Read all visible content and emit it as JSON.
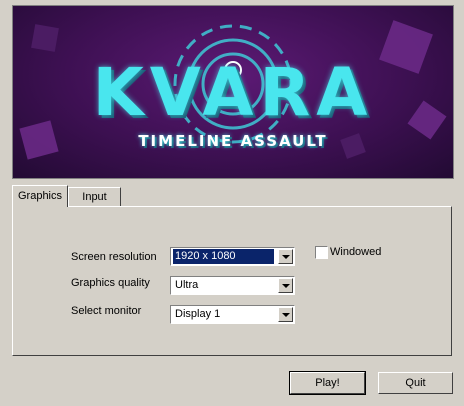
{
  "banner": {
    "logo_title": "KVARA",
    "logo_subtitle": "TIMELINE ASSAULT",
    "colors": {
      "background": "#3d1052",
      "logo": "#49e6ee"
    }
  },
  "tabs": [
    {
      "label": "Graphics",
      "active": true
    },
    {
      "label": "Input",
      "active": false
    }
  ],
  "graphics": {
    "resolution": {
      "label": "Screen resolution",
      "value": "1920 x 1080"
    },
    "quality": {
      "label": "Graphics quality",
      "value": "Ultra"
    },
    "monitor": {
      "label": "Select monitor",
      "value": "Display 1"
    },
    "windowed": {
      "label": "Windowed",
      "checked": false
    }
  },
  "buttons": {
    "play": "Play!",
    "quit": "Quit"
  }
}
